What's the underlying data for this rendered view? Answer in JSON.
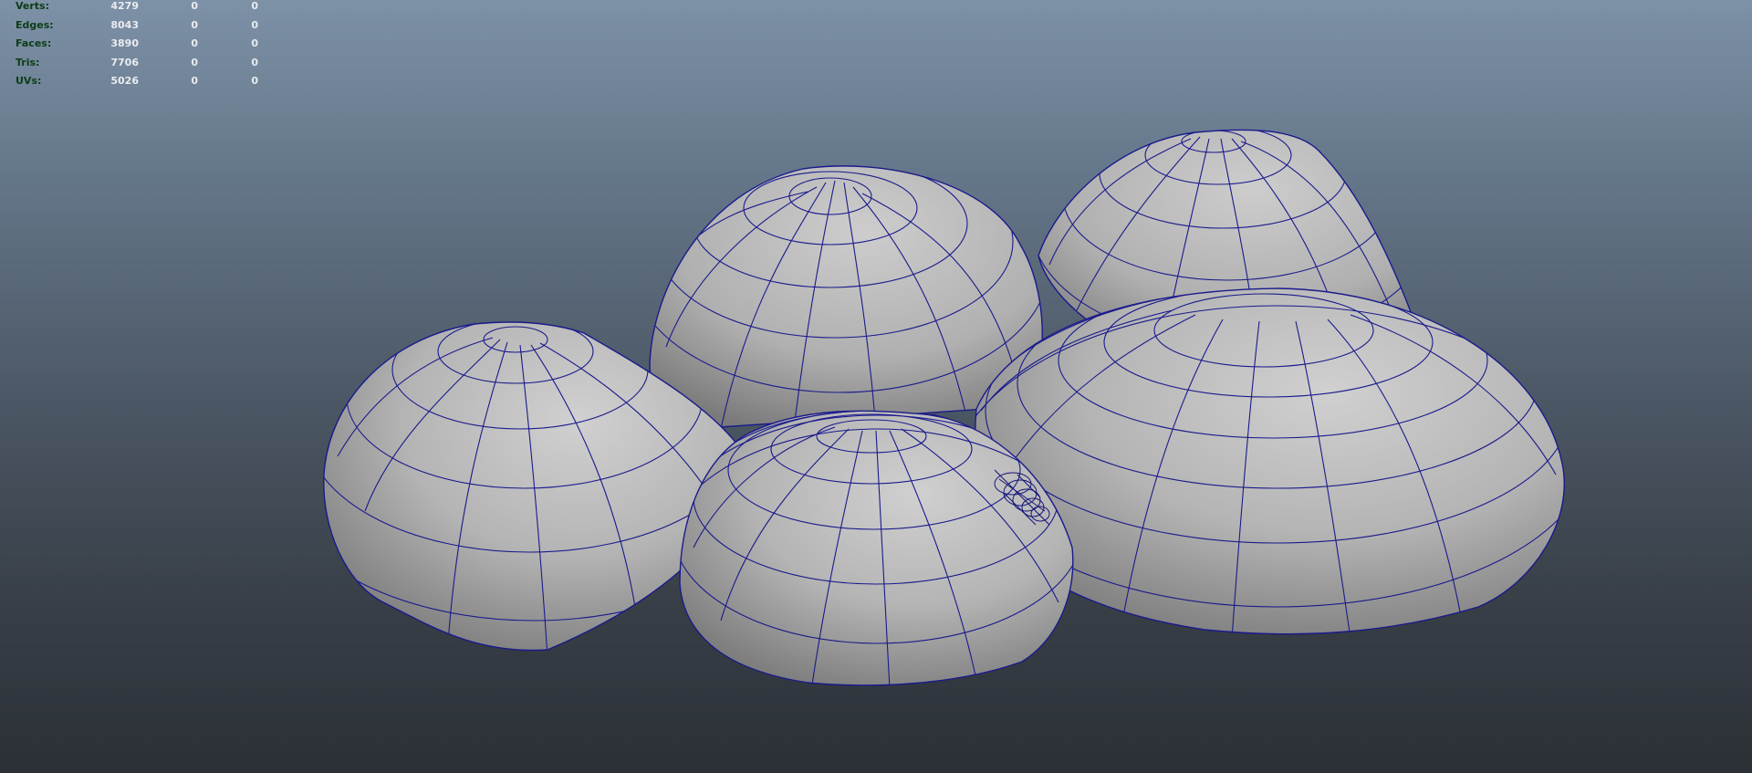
{
  "hud": {
    "rows": [
      {
        "label": "Verts:",
        "total": "4279",
        "selected": "0",
        "third": "0"
      },
      {
        "label": "Edges:",
        "total": "8043",
        "selected": "0",
        "third": "0"
      },
      {
        "label": "Faces:",
        "total": "3890",
        "selected": "0",
        "third": "0"
      },
      {
        "label": "Tris:",
        "total": "7706",
        "selected": "0",
        "third": "0"
      },
      {
        "label": "UVs:",
        "total": "5026",
        "selected": "0",
        "third": "0"
      }
    ]
  },
  "colors": {
    "wireframe": "#1a1a8c",
    "hud_label": "#0d3d17",
    "hud_value": "#e9ecef"
  }
}
